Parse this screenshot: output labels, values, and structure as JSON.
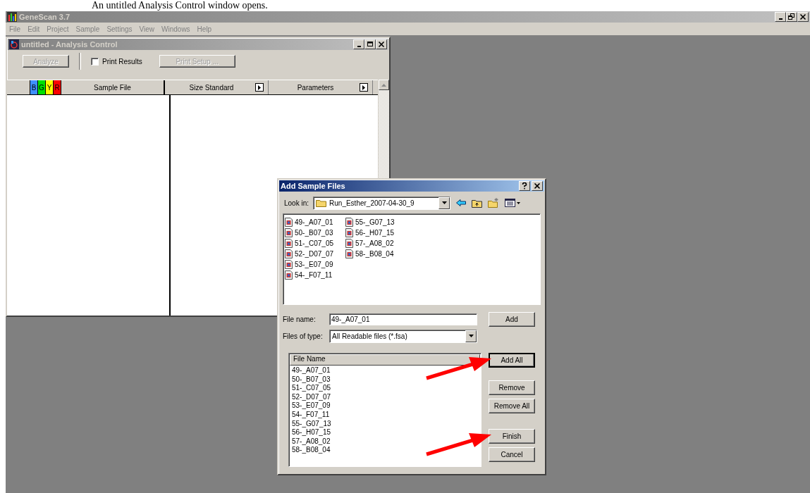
{
  "caption": "An untitled Analysis Control window opens.",
  "app": {
    "title": "GeneScan 3.7",
    "menu": [
      "File",
      "Edit",
      "Project",
      "Sample",
      "Settings",
      "View",
      "Windows",
      "Help"
    ]
  },
  "analysis_window": {
    "title": "untitled - Analysis Control",
    "analyze_button": {
      "label": "Analyze",
      "disabled": true
    },
    "print_results": {
      "label": "Print Results",
      "checked": false
    },
    "print_setup_button": {
      "label": "Print Setup ...",
      "disabled": true
    },
    "dyes": [
      {
        "label": "B",
        "color": "#3f8fff"
      },
      {
        "label": "G",
        "color": "#00e000"
      },
      {
        "label": "Y",
        "color": "#ffff00"
      },
      {
        "label": "R",
        "color": "#ff0000"
      }
    ],
    "columns": [
      {
        "label": "Sample File",
        "kind": "plain"
      },
      {
        "label": "Size Standard",
        "kind": "menu"
      },
      {
        "label": "Parameters",
        "kind": "menu"
      }
    ]
  },
  "dialog": {
    "title": "Add Sample Files",
    "look_in_label": "Look in:",
    "look_in_value": "Run_Esther_2007-04-30_9",
    "files": [
      "49-_A07_01",
      "50-_B07_03",
      "51-_C07_05",
      "52-_D07_07",
      "53-_E07_09",
      "54-_F07_11",
      "55-_G07_13",
      "56-_H07_15",
      "57-_A08_02",
      "58-_B08_04"
    ],
    "file_name_label": "File name:",
    "file_name_value": "49-_A07_01",
    "file_type_label": "Files of type:",
    "file_type_value": "All Readable files (*.fsa)",
    "add_button": "Add",
    "list_header": "File Name",
    "list_items": [
      "49-_A07_01",
      "50-_B07_03",
      "51-_C07_05",
      "52-_D07_07",
      "53-_E07_09",
      "54-_F07_11",
      "55-_G07_13",
      "56-_H07_15",
      "57-_A08_02",
      "58-_B08_04"
    ],
    "buttons": [
      {
        "label": "Add All",
        "default": true,
        "arrow": true
      },
      {
        "label": "Remove",
        "default": false,
        "arrow": false
      },
      {
        "label": "Remove All",
        "default": false,
        "arrow": false
      },
      {
        "label": "Finish",
        "default": false,
        "arrow": true
      },
      {
        "label": "Cancel",
        "default": false,
        "arrow": false
      }
    ]
  }
}
